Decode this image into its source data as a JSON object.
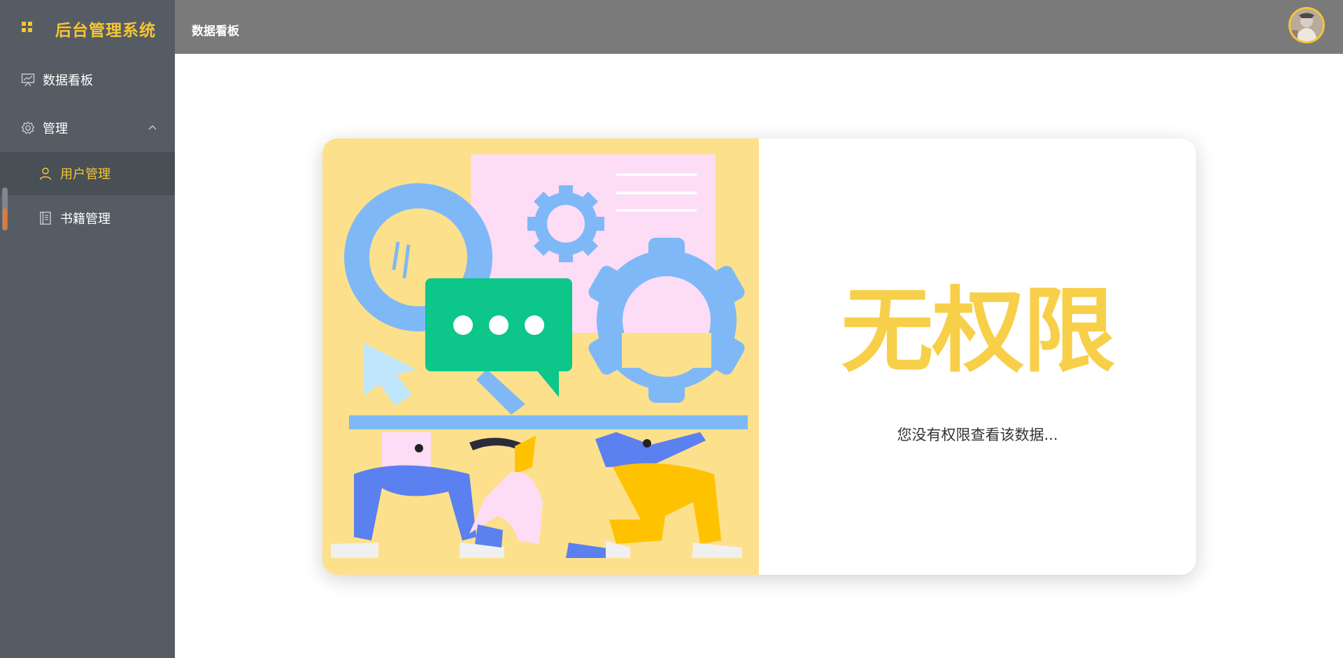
{
  "app": {
    "title": "后台管理系统"
  },
  "sidebar": {
    "items": [
      {
        "label": "数据看板",
        "icon": "chart-board-icon"
      },
      {
        "label": "管理",
        "icon": "gear-icon",
        "expanded": true,
        "children": [
          {
            "label": "用户管理",
            "icon": "user-icon",
            "active": true
          },
          {
            "label": "书籍管理",
            "icon": "book-icon"
          }
        ]
      }
    ]
  },
  "header": {
    "breadcrumb": "数据看板"
  },
  "main": {
    "title": "无权限",
    "message": "您没有权限查看该数据..."
  },
  "colors": {
    "accent": "#f5c534",
    "sidebar": "#555c63",
    "topbar": "#7a7a7a",
    "title": "#f8cf48"
  }
}
